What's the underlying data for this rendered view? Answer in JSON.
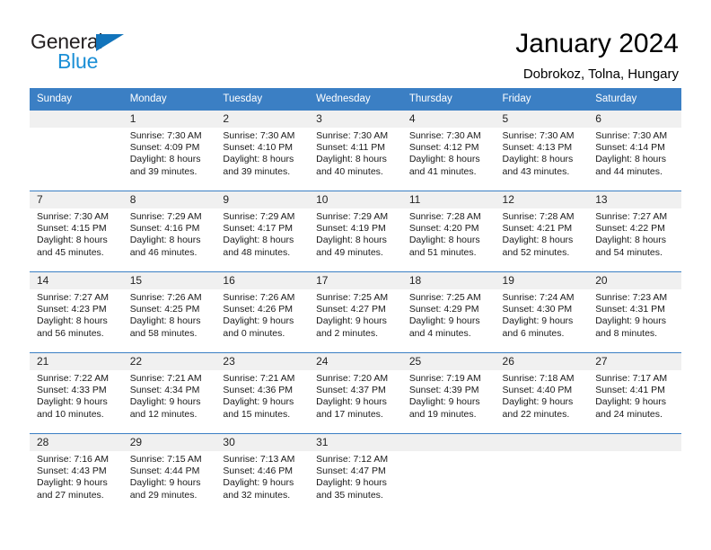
{
  "brand": {
    "name_part1": "General",
    "name_part2": "Blue",
    "color_dark": "#231f20",
    "color_blue": "#1b8fd6",
    "triangle_color": "#1274bb"
  },
  "header": {
    "title": "January 2024",
    "subtitle": "Dobrokoz, Tolna, Hungary",
    "accent_color": "#3b7fc4"
  },
  "weekday_headers": [
    "Sunday",
    "Monday",
    "Tuesday",
    "Wednesday",
    "Thursday",
    "Friday",
    "Saturday"
  ],
  "weeks": [
    [
      {
        "day": "",
        "sunrise": "",
        "sunset": "",
        "daylight1": "",
        "daylight2": "",
        "empty": true
      },
      {
        "day": "1",
        "sunrise": "Sunrise: 7:30 AM",
        "sunset": "Sunset: 4:09 PM",
        "daylight1": "Daylight: 8 hours",
        "daylight2": "and 39 minutes."
      },
      {
        "day": "2",
        "sunrise": "Sunrise: 7:30 AM",
        "sunset": "Sunset: 4:10 PM",
        "daylight1": "Daylight: 8 hours",
        "daylight2": "and 39 minutes."
      },
      {
        "day": "3",
        "sunrise": "Sunrise: 7:30 AM",
        "sunset": "Sunset: 4:11 PM",
        "daylight1": "Daylight: 8 hours",
        "daylight2": "and 40 minutes."
      },
      {
        "day": "4",
        "sunrise": "Sunrise: 7:30 AM",
        "sunset": "Sunset: 4:12 PM",
        "daylight1": "Daylight: 8 hours",
        "daylight2": "and 41 minutes."
      },
      {
        "day": "5",
        "sunrise": "Sunrise: 7:30 AM",
        "sunset": "Sunset: 4:13 PM",
        "daylight1": "Daylight: 8 hours",
        "daylight2": "and 43 minutes."
      },
      {
        "day": "6",
        "sunrise": "Sunrise: 7:30 AM",
        "sunset": "Sunset: 4:14 PM",
        "daylight1": "Daylight: 8 hours",
        "daylight2": "and 44 minutes."
      }
    ],
    [
      {
        "day": "7",
        "sunrise": "Sunrise: 7:30 AM",
        "sunset": "Sunset: 4:15 PM",
        "daylight1": "Daylight: 8 hours",
        "daylight2": "and 45 minutes."
      },
      {
        "day": "8",
        "sunrise": "Sunrise: 7:29 AM",
        "sunset": "Sunset: 4:16 PM",
        "daylight1": "Daylight: 8 hours",
        "daylight2": "and 46 minutes."
      },
      {
        "day": "9",
        "sunrise": "Sunrise: 7:29 AM",
        "sunset": "Sunset: 4:17 PM",
        "daylight1": "Daylight: 8 hours",
        "daylight2": "and 48 minutes."
      },
      {
        "day": "10",
        "sunrise": "Sunrise: 7:29 AM",
        "sunset": "Sunset: 4:19 PM",
        "daylight1": "Daylight: 8 hours",
        "daylight2": "and 49 minutes."
      },
      {
        "day": "11",
        "sunrise": "Sunrise: 7:28 AM",
        "sunset": "Sunset: 4:20 PM",
        "daylight1": "Daylight: 8 hours",
        "daylight2": "and 51 minutes."
      },
      {
        "day": "12",
        "sunrise": "Sunrise: 7:28 AM",
        "sunset": "Sunset: 4:21 PM",
        "daylight1": "Daylight: 8 hours",
        "daylight2": "and 52 minutes."
      },
      {
        "day": "13",
        "sunrise": "Sunrise: 7:27 AM",
        "sunset": "Sunset: 4:22 PM",
        "daylight1": "Daylight: 8 hours",
        "daylight2": "and 54 minutes."
      }
    ],
    [
      {
        "day": "14",
        "sunrise": "Sunrise: 7:27 AM",
        "sunset": "Sunset: 4:23 PM",
        "daylight1": "Daylight: 8 hours",
        "daylight2": "and 56 minutes."
      },
      {
        "day": "15",
        "sunrise": "Sunrise: 7:26 AM",
        "sunset": "Sunset: 4:25 PM",
        "daylight1": "Daylight: 8 hours",
        "daylight2": "and 58 minutes."
      },
      {
        "day": "16",
        "sunrise": "Sunrise: 7:26 AM",
        "sunset": "Sunset: 4:26 PM",
        "daylight1": "Daylight: 9 hours",
        "daylight2": "and 0 minutes."
      },
      {
        "day": "17",
        "sunrise": "Sunrise: 7:25 AM",
        "sunset": "Sunset: 4:27 PM",
        "daylight1": "Daylight: 9 hours",
        "daylight2": "and 2 minutes."
      },
      {
        "day": "18",
        "sunrise": "Sunrise: 7:25 AM",
        "sunset": "Sunset: 4:29 PM",
        "daylight1": "Daylight: 9 hours",
        "daylight2": "and 4 minutes."
      },
      {
        "day": "19",
        "sunrise": "Sunrise: 7:24 AM",
        "sunset": "Sunset: 4:30 PM",
        "daylight1": "Daylight: 9 hours",
        "daylight2": "and 6 minutes."
      },
      {
        "day": "20",
        "sunrise": "Sunrise: 7:23 AM",
        "sunset": "Sunset: 4:31 PM",
        "daylight1": "Daylight: 9 hours",
        "daylight2": "and 8 minutes."
      }
    ],
    [
      {
        "day": "21",
        "sunrise": "Sunrise: 7:22 AM",
        "sunset": "Sunset: 4:33 PM",
        "daylight1": "Daylight: 9 hours",
        "daylight2": "and 10 minutes."
      },
      {
        "day": "22",
        "sunrise": "Sunrise: 7:21 AM",
        "sunset": "Sunset: 4:34 PM",
        "daylight1": "Daylight: 9 hours",
        "daylight2": "and 12 minutes."
      },
      {
        "day": "23",
        "sunrise": "Sunrise: 7:21 AM",
        "sunset": "Sunset: 4:36 PM",
        "daylight1": "Daylight: 9 hours",
        "daylight2": "and 15 minutes."
      },
      {
        "day": "24",
        "sunrise": "Sunrise: 7:20 AM",
        "sunset": "Sunset: 4:37 PM",
        "daylight1": "Daylight: 9 hours",
        "daylight2": "and 17 minutes."
      },
      {
        "day": "25",
        "sunrise": "Sunrise: 7:19 AM",
        "sunset": "Sunset: 4:39 PM",
        "daylight1": "Daylight: 9 hours",
        "daylight2": "and 19 minutes."
      },
      {
        "day": "26",
        "sunrise": "Sunrise: 7:18 AM",
        "sunset": "Sunset: 4:40 PM",
        "daylight1": "Daylight: 9 hours",
        "daylight2": "and 22 minutes."
      },
      {
        "day": "27",
        "sunrise": "Sunrise: 7:17 AM",
        "sunset": "Sunset: 4:41 PM",
        "daylight1": "Daylight: 9 hours",
        "daylight2": "and 24 minutes."
      }
    ],
    [
      {
        "day": "28",
        "sunrise": "Sunrise: 7:16 AM",
        "sunset": "Sunset: 4:43 PM",
        "daylight1": "Daylight: 9 hours",
        "daylight2": "and 27 minutes."
      },
      {
        "day": "29",
        "sunrise": "Sunrise: 7:15 AM",
        "sunset": "Sunset: 4:44 PM",
        "daylight1": "Daylight: 9 hours",
        "daylight2": "and 29 minutes."
      },
      {
        "day": "30",
        "sunrise": "Sunrise: 7:13 AM",
        "sunset": "Sunset: 4:46 PM",
        "daylight1": "Daylight: 9 hours",
        "daylight2": "and 32 minutes."
      },
      {
        "day": "31",
        "sunrise": "Sunrise: 7:12 AM",
        "sunset": "Sunset: 4:47 PM",
        "daylight1": "Daylight: 9 hours",
        "daylight2": "and 35 minutes."
      },
      {
        "day": "",
        "sunrise": "",
        "sunset": "",
        "daylight1": "",
        "daylight2": "",
        "empty": true
      },
      {
        "day": "",
        "sunrise": "",
        "sunset": "",
        "daylight1": "",
        "daylight2": "",
        "empty": true
      },
      {
        "day": "",
        "sunrise": "",
        "sunset": "",
        "daylight1": "",
        "daylight2": "",
        "empty": true
      }
    ]
  ]
}
